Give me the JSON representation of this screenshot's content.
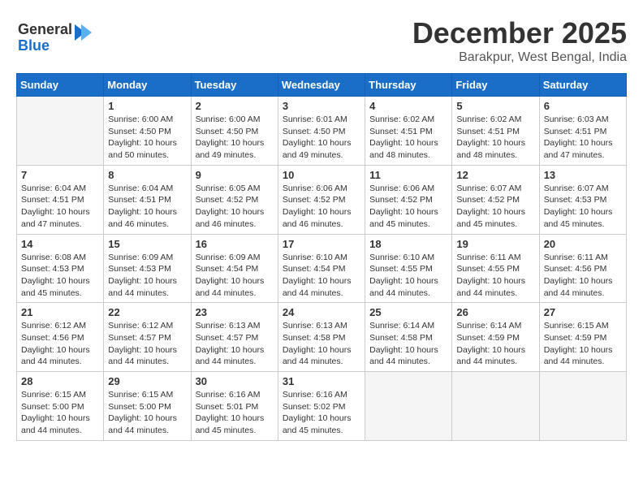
{
  "header": {
    "logo_line1": "General",
    "logo_line2": "Blue",
    "title": "December 2025",
    "subtitle": "Barakpur, West Bengal, India"
  },
  "weekdays": [
    "Sunday",
    "Monday",
    "Tuesday",
    "Wednesday",
    "Thursday",
    "Friday",
    "Saturday"
  ],
  "weeks": [
    [
      {
        "day": "",
        "empty": true
      },
      {
        "day": "1",
        "sunrise": "Sunrise: 6:00 AM",
        "sunset": "Sunset: 4:50 PM",
        "daylight": "Daylight: 10 hours and 50 minutes."
      },
      {
        "day": "2",
        "sunrise": "Sunrise: 6:00 AM",
        "sunset": "Sunset: 4:50 PM",
        "daylight": "Daylight: 10 hours and 49 minutes."
      },
      {
        "day": "3",
        "sunrise": "Sunrise: 6:01 AM",
        "sunset": "Sunset: 4:50 PM",
        "daylight": "Daylight: 10 hours and 49 minutes."
      },
      {
        "day": "4",
        "sunrise": "Sunrise: 6:02 AM",
        "sunset": "Sunset: 4:51 PM",
        "daylight": "Daylight: 10 hours and 48 minutes."
      },
      {
        "day": "5",
        "sunrise": "Sunrise: 6:02 AM",
        "sunset": "Sunset: 4:51 PM",
        "daylight": "Daylight: 10 hours and 48 minutes."
      },
      {
        "day": "6",
        "sunrise": "Sunrise: 6:03 AM",
        "sunset": "Sunset: 4:51 PM",
        "daylight": "Daylight: 10 hours and 47 minutes."
      }
    ],
    [
      {
        "day": "7",
        "sunrise": "Sunrise: 6:04 AM",
        "sunset": "Sunset: 4:51 PM",
        "daylight": "Daylight: 10 hours and 47 minutes."
      },
      {
        "day": "8",
        "sunrise": "Sunrise: 6:04 AM",
        "sunset": "Sunset: 4:51 PM",
        "daylight": "Daylight: 10 hours and 46 minutes."
      },
      {
        "day": "9",
        "sunrise": "Sunrise: 6:05 AM",
        "sunset": "Sunset: 4:52 PM",
        "daylight": "Daylight: 10 hours and 46 minutes."
      },
      {
        "day": "10",
        "sunrise": "Sunrise: 6:06 AM",
        "sunset": "Sunset: 4:52 PM",
        "daylight": "Daylight: 10 hours and 46 minutes."
      },
      {
        "day": "11",
        "sunrise": "Sunrise: 6:06 AM",
        "sunset": "Sunset: 4:52 PM",
        "daylight": "Daylight: 10 hours and 45 minutes."
      },
      {
        "day": "12",
        "sunrise": "Sunrise: 6:07 AM",
        "sunset": "Sunset: 4:52 PM",
        "daylight": "Daylight: 10 hours and 45 minutes."
      },
      {
        "day": "13",
        "sunrise": "Sunrise: 6:07 AM",
        "sunset": "Sunset: 4:53 PM",
        "daylight": "Daylight: 10 hours and 45 minutes."
      }
    ],
    [
      {
        "day": "14",
        "sunrise": "Sunrise: 6:08 AM",
        "sunset": "Sunset: 4:53 PM",
        "daylight": "Daylight: 10 hours and 45 minutes."
      },
      {
        "day": "15",
        "sunrise": "Sunrise: 6:09 AM",
        "sunset": "Sunset: 4:53 PM",
        "daylight": "Daylight: 10 hours and 44 minutes."
      },
      {
        "day": "16",
        "sunrise": "Sunrise: 6:09 AM",
        "sunset": "Sunset: 4:54 PM",
        "daylight": "Daylight: 10 hours and 44 minutes."
      },
      {
        "day": "17",
        "sunrise": "Sunrise: 6:10 AM",
        "sunset": "Sunset: 4:54 PM",
        "daylight": "Daylight: 10 hours and 44 minutes."
      },
      {
        "day": "18",
        "sunrise": "Sunrise: 6:10 AM",
        "sunset": "Sunset: 4:55 PM",
        "daylight": "Daylight: 10 hours and 44 minutes."
      },
      {
        "day": "19",
        "sunrise": "Sunrise: 6:11 AM",
        "sunset": "Sunset: 4:55 PM",
        "daylight": "Daylight: 10 hours and 44 minutes."
      },
      {
        "day": "20",
        "sunrise": "Sunrise: 6:11 AM",
        "sunset": "Sunset: 4:56 PM",
        "daylight": "Daylight: 10 hours and 44 minutes."
      }
    ],
    [
      {
        "day": "21",
        "sunrise": "Sunrise: 6:12 AM",
        "sunset": "Sunset: 4:56 PM",
        "daylight": "Daylight: 10 hours and 44 minutes."
      },
      {
        "day": "22",
        "sunrise": "Sunrise: 6:12 AM",
        "sunset": "Sunset: 4:57 PM",
        "daylight": "Daylight: 10 hours and 44 minutes."
      },
      {
        "day": "23",
        "sunrise": "Sunrise: 6:13 AM",
        "sunset": "Sunset: 4:57 PM",
        "daylight": "Daylight: 10 hours and 44 minutes."
      },
      {
        "day": "24",
        "sunrise": "Sunrise: 6:13 AM",
        "sunset": "Sunset: 4:58 PM",
        "daylight": "Daylight: 10 hours and 44 minutes."
      },
      {
        "day": "25",
        "sunrise": "Sunrise: 6:14 AM",
        "sunset": "Sunset: 4:58 PM",
        "daylight": "Daylight: 10 hours and 44 minutes."
      },
      {
        "day": "26",
        "sunrise": "Sunrise: 6:14 AM",
        "sunset": "Sunset: 4:59 PM",
        "daylight": "Daylight: 10 hours and 44 minutes."
      },
      {
        "day": "27",
        "sunrise": "Sunrise: 6:15 AM",
        "sunset": "Sunset: 4:59 PM",
        "daylight": "Daylight: 10 hours and 44 minutes."
      }
    ],
    [
      {
        "day": "28",
        "sunrise": "Sunrise: 6:15 AM",
        "sunset": "Sunset: 5:00 PM",
        "daylight": "Daylight: 10 hours and 44 minutes."
      },
      {
        "day": "29",
        "sunrise": "Sunrise: 6:15 AM",
        "sunset": "Sunset: 5:00 PM",
        "daylight": "Daylight: 10 hours and 44 minutes."
      },
      {
        "day": "30",
        "sunrise": "Sunrise: 6:16 AM",
        "sunset": "Sunset: 5:01 PM",
        "daylight": "Daylight: 10 hours and 45 minutes."
      },
      {
        "day": "31",
        "sunrise": "Sunrise: 6:16 AM",
        "sunset": "Sunset: 5:02 PM",
        "daylight": "Daylight: 10 hours and 45 minutes."
      },
      {
        "day": "",
        "empty": true
      },
      {
        "day": "",
        "empty": true
      },
      {
        "day": "",
        "empty": true
      }
    ]
  ]
}
